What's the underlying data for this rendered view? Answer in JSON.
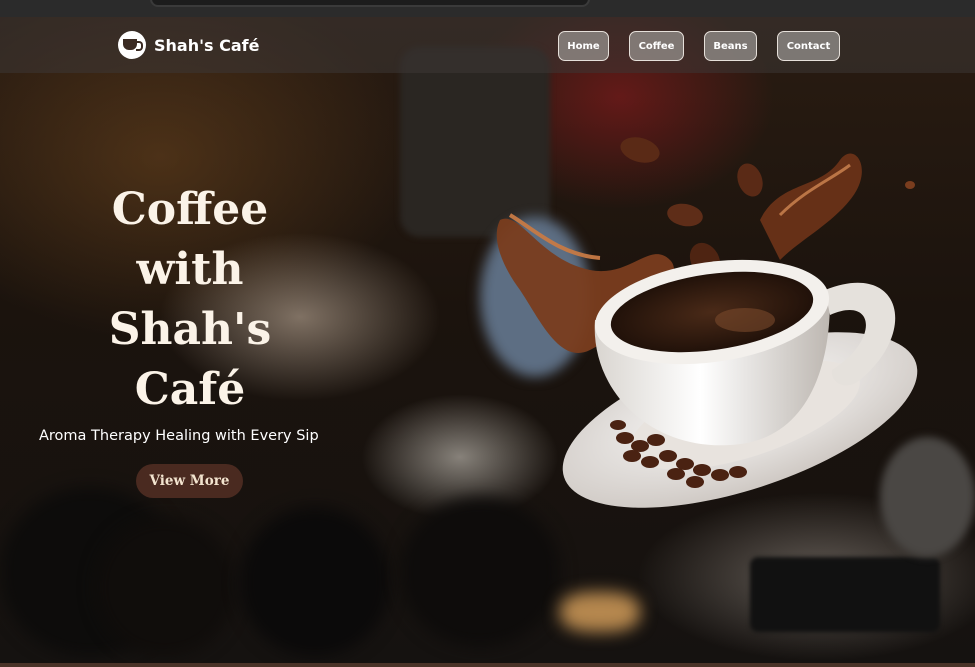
{
  "brand": {
    "name": "Shah's Café",
    "logo_icon": "coffee-cup-icon"
  },
  "nav": {
    "items": [
      {
        "label": "Home"
      },
      {
        "label": "Coffee"
      },
      {
        "label": "Beans"
      },
      {
        "label": "Contact"
      }
    ]
  },
  "hero": {
    "title_lines": [
      "Coffee",
      "with",
      "Shah's",
      "Café"
    ],
    "subtitle": "Aroma Therapy Healing with Every Sip",
    "cta_label": "View More"
  },
  "colors": {
    "title": "#fbf3e8",
    "cta_background": "#4a2a20",
    "cta_text": "#f3e4cf",
    "nav_button": "#96918e"
  }
}
